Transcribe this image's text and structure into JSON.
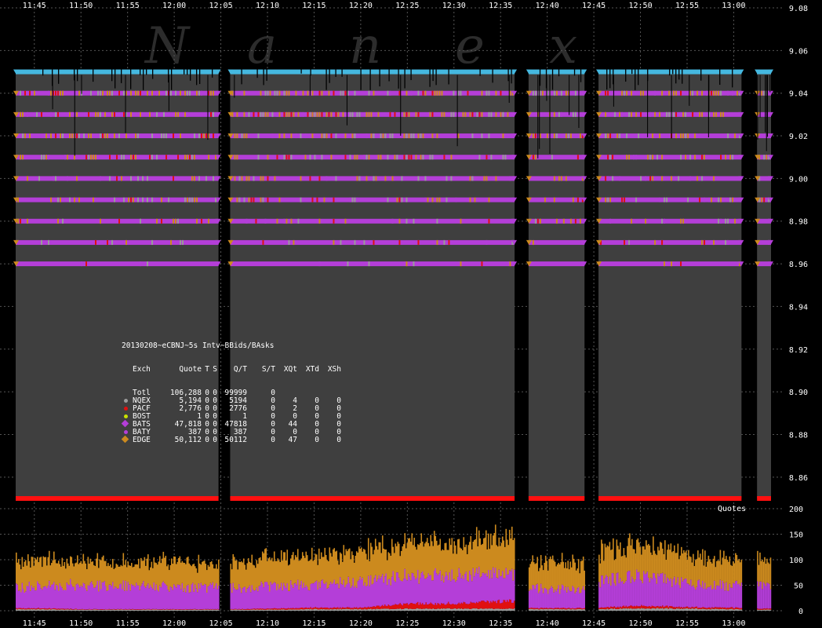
{
  "watermark": [
    "N",
    "a",
    "n",
    "e",
    "x"
  ],
  "quotes_label": "Quotes",
  "colors": {
    "background": "#000000",
    "panel": "#3f3f3f",
    "grid": "#555555",
    "total_band": "#45b8e0",
    "NQEX": "#9a9a9a",
    "PACF": "#e01010",
    "BOST": "#c8e000",
    "BATS": "#b43ed8",
    "BATY": "#b43ed8",
    "EDGE": "#cc8a1e",
    "nbbo_bid": "#ff1010"
  },
  "stats": {
    "title": "20130208~eCBNJ~5s Intv~BBids/BAsks",
    "header": [
      "Exch",
      "Quote",
      "T",
      "S",
      "Q/T",
      "S/T",
      "XQt",
      "XTd",
      "XSh"
    ],
    "rows": [
      {
        "exch": "Totl",
        "quote": "106,288",
        "t": "0",
        "s": "0",
        "qt": "99999",
        "st": "0",
        "xqt": "",
        "xtd": "",
        "xsh": "",
        "marker": "none",
        "color": ""
      },
      {
        "exch": "NQEX",
        "quote": "5,194",
        "t": "0",
        "s": "0",
        "qt": "5194",
        "st": "0",
        "xqt": "4",
        "xtd": "0",
        "xsh": "0",
        "marker": "dot",
        "color": "#9a9a9a"
      },
      {
        "exch": "PACF",
        "quote": "2,776",
        "t": "0",
        "s": "0",
        "qt": "2776",
        "st": "0",
        "xqt": "2",
        "xtd": "0",
        "xsh": "0",
        "marker": "dot",
        "color": "#e01010"
      },
      {
        "exch": "BOST",
        "quote": "1",
        "t": "0",
        "s": "0",
        "qt": "1",
        "st": "0",
        "xqt": "0",
        "xtd": "0",
        "xsh": "0",
        "marker": "dot",
        "color": "#c8e000"
      },
      {
        "exch": "BATS",
        "quote": "47,818",
        "t": "0",
        "s": "0",
        "qt": "47818",
        "st": "0",
        "xqt": "44",
        "xtd": "0",
        "xsh": "0",
        "marker": "diamond",
        "color": "#b43ed8"
      },
      {
        "exch": "BATY",
        "quote": "387",
        "t": "0",
        "s": "0",
        "qt": "387",
        "st": "0",
        "xqt": "0",
        "xtd": "0",
        "xsh": "0",
        "marker": "dot",
        "color": "#b43ed8"
      },
      {
        "exch": "EDGE",
        "quote": "50,112",
        "t": "0",
        "s": "0",
        "qt": "50112",
        "st": "0",
        "xqt": "47",
        "xtd": "0",
        "xsh": "0",
        "marker": "diamond",
        "color": "#cc8a1e"
      }
    ]
  },
  "chart_data": [
    {
      "type": "line",
      "title": "",
      "x_ticks": [
        "11:45",
        "11:50",
        "11:55",
        "12:00",
        "12:05",
        "12:10",
        "12:15",
        "12:20",
        "12:25",
        "12:30",
        "12:35",
        "12:40",
        "12:45",
        "12:50",
        "12:55",
        "13:00"
      ],
      "xlim": [
        "11:43",
        "13:04"
      ],
      "ylim": [
        8.85,
        9.08
      ],
      "y_ticks": [
        "9.08",
        "9.06",
        "9.04",
        "9.02",
        "9.00",
        "8.98",
        "8.96",
        "8.94",
        "8.92",
        "8.90",
        "8.88",
        "8.86"
      ],
      "grid": true,
      "best_ask_levels": [
        9.05,
        9.04,
        9.03,
        9.02,
        9.01,
        9.0,
        8.99,
        8.98,
        8.97,
        8.96
      ],
      "best_bid": 8.85,
      "gaps": [
        [
          "12:04:45",
          "12:06"
        ],
        [
          "12:36:30",
          "12:38"
        ],
        [
          "12:44",
          "12:45:30"
        ],
        [
          "13:00:50",
          "13:02:30"
        ]
      ],
      "series": [
        {
          "name": "NQEX",
          "color": "#9a9a9a"
        },
        {
          "name": "PACF",
          "color": "#e01010"
        },
        {
          "name": "BOST",
          "color": "#c8e000"
        },
        {
          "name": "BATS",
          "color": "#b43ed8"
        },
        {
          "name": "BATY",
          "color": "#b43ed8"
        },
        {
          "name": "EDGE",
          "color": "#cc8a1e"
        }
      ]
    },
    {
      "type": "area",
      "title": "",
      "ylabel": "Quotes",
      "ylim": [
        0,
        200
      ],
      "y_ticks": [
        "200",
        "150",
        "100",
        "50",
        "0"
      ],
      "x_ticks": [
        "11:45",
        "11:50",
        "11:55",
        "12:00",
        "12:05",
        "12:10",
        "12:15",
        "12:20",
        "12:25",
        "12:30",
        "12:35",
        "12:40",
        "12:45",
        "12:50",
        "12:55",
        "13:00"
      ],
      "x": [
        "11:43",
        "11:45",
        "11:50",
        "11:55",
        "12:00",
        "12:04",
        "12:06",
        "12:10",
        "12:15",
        "12:20",
        "12:25",
        "12:30",
        "12:35",
        "12:36",
        "12:38",
        "12:40",
        "12:44",
        "12:45",
        "12:50",
        "12:55",
        "13:00",
        "13:02"
      ],
      "series": [
        {
          "name": "NQEX",
          "color": "#9a9a9a",
          "values": [
            3,
            3,
            2,
            2,
            2,
            2,
            2,
            2,
            3,
            3,
            4,
            4,
            4,
            4,
            3,
            3,
            3,
            3,
            5,
            4,
            3,
            2
          ]
        },
        {
          "name": "PACF",
          "color": "#e01010",
          "values": [
            2,
            2,
            1,
            1,
            1,
            1,
            1,
            2,
            3,
            3,
            10,
            10,
            15,
            15,
            2,
            2,
            2,
            3,
            5,
            3,
            3,
            2
          ]
        },
        {
          "name": "BATS",
          "color": "#b43ed8",
          "values": [
            40,
            42,
            48,
            45,
            44,
            42,
            42,
            44,
            45,
            50,
            55,
            55,
            55,
            55,
            38,
            38,
            36,
            52,
            58,
            45,
            42,
            45
          ]
        },
        {
          "name": "EDGE",
          "color": "#cc8a1e",
          "values": [
            50,
            52,
            48,
            45,
            48,
            45,
            48,
            55,
            58,
            60,
            62,
            65,
            70,
            70,
            50,
            52,
            50,
            60,
            60,
            55,
            50,
            50
          ]
        }
      ]
    }
  ]
}
